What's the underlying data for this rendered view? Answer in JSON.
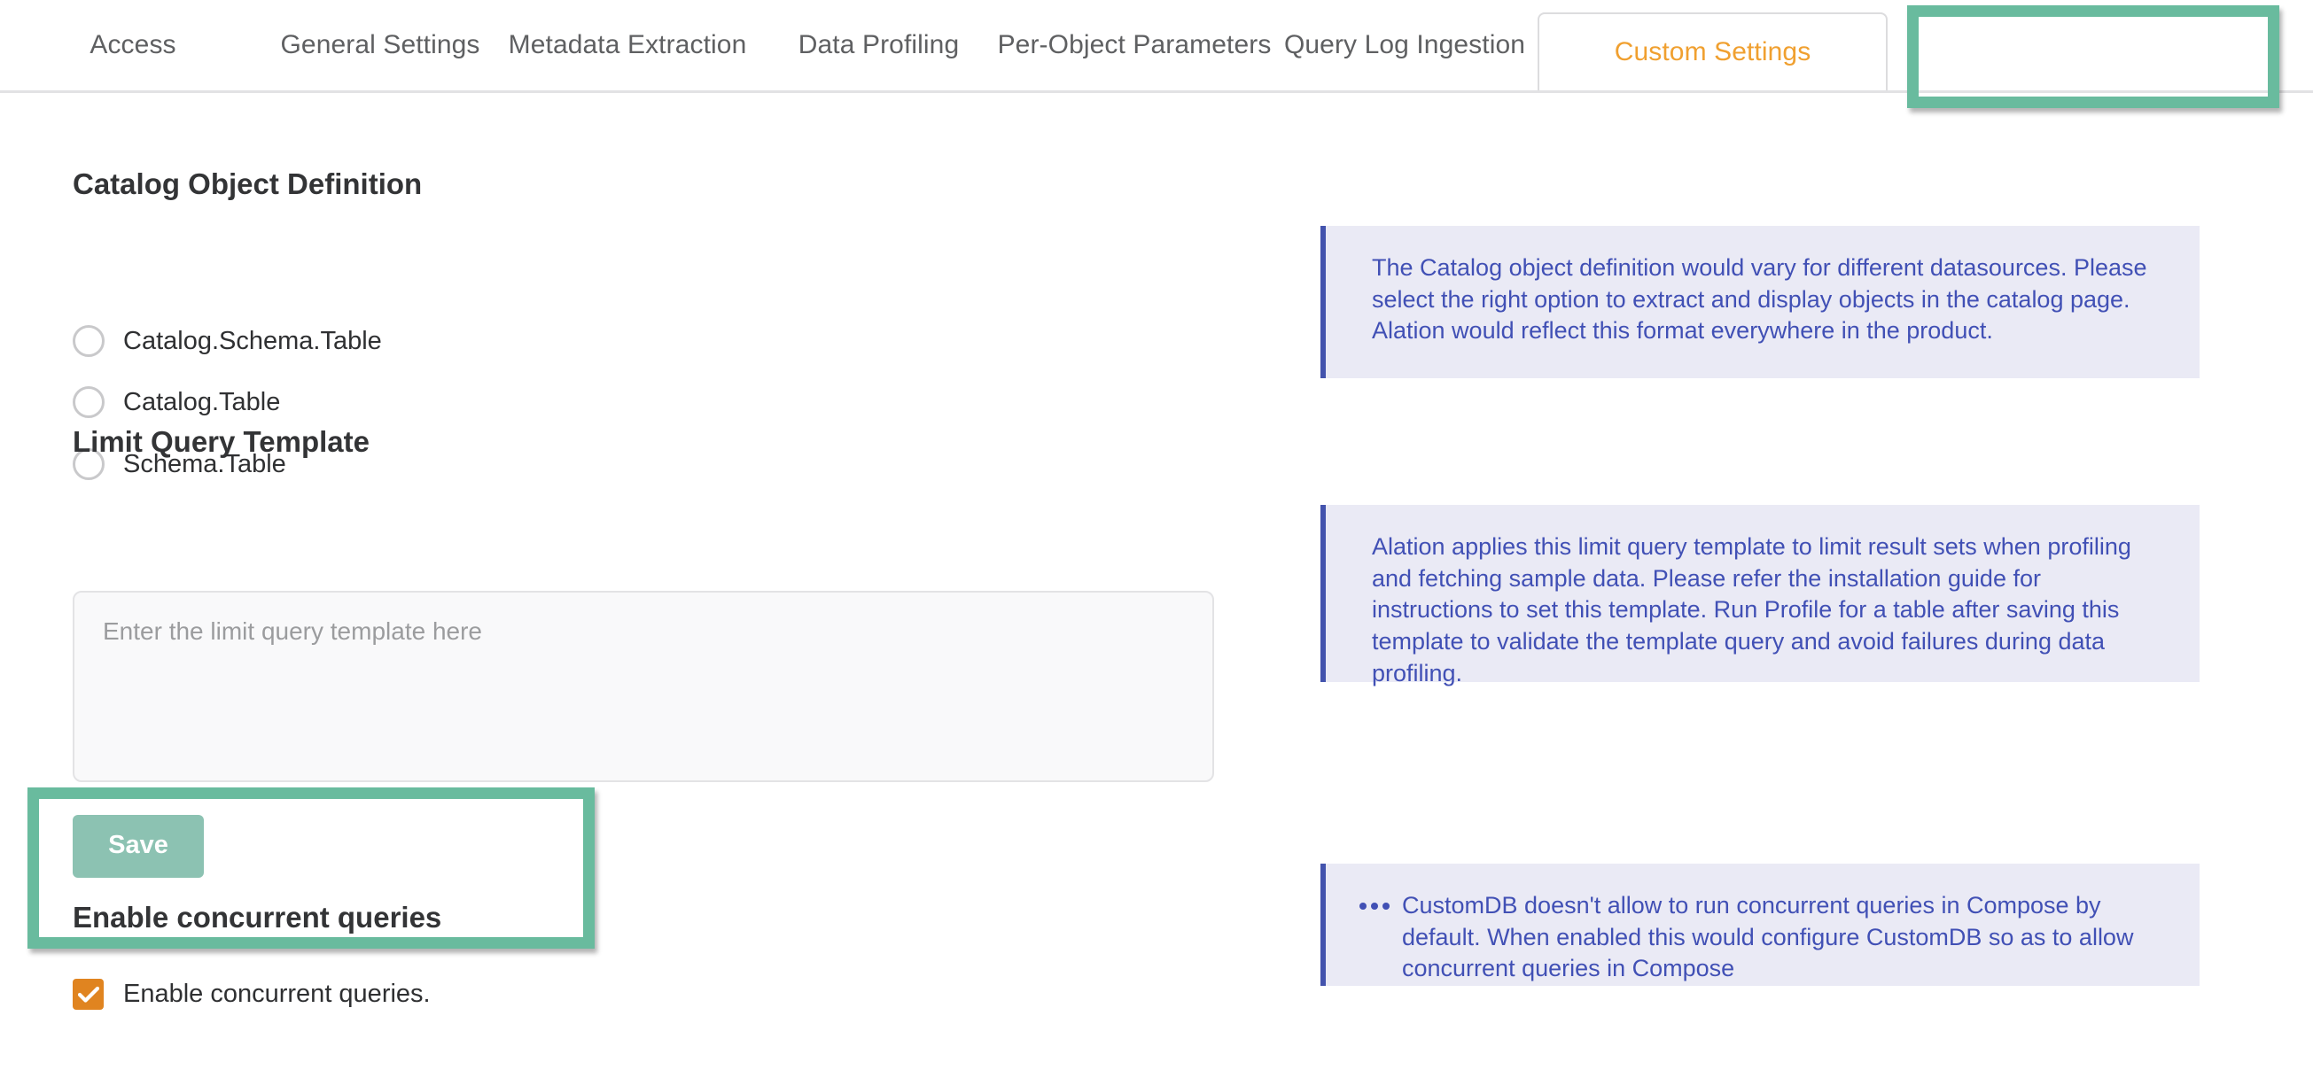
{
  "tabs": [
    {
      "label": "Access",
      "key": "access",
      "active": false
    },
    {
      "label": "General Settings",
      "key": "general",
      "active": false
    },
    {
      "label": "Metadata Extraction",
      "key": "metadata",
      "active": false
    },
    {
      "label": "Data Profiling",
      "key": "profiling",
      "active": false
    },
    {
      "label": "Per-Object Parameters",
      "key": "perobject",
      "active": false
    },
    {
      "label": "Query Log Ingestion",
      "key": "querylog",
      "active": false
    },
    {
      "label": "Custom Settings",
      "key": "custom",
      "active": true
    }
  ],
  "catalog_object_definition": {
    "heading": "Catalog Object Definition",
    "options": [
      {
        "label": "Catalog.Schema.Table",
        "selected": false
      },
      {
        "label": "Catalog.Table",
        "selected": false
      },
      {
        "label": "Schema.Table",
        "selected": false
      }
    ]
  },
  "limit_query_template": {
    "heading": "Limit Query Template",
    "value": "",
    "placeholder": "Enter the limit query template here"
  },
  "actions": {
    "save_label": "Save"
  },
  "enable_concurrent_queries": {
    "heading": "Enable concurrent queries",
    "checkbox_label": "Enable concurrent queries.",
    "checked": true
  },
  "info_panels": [
    {
      "id": "catalog-object-definition-info",
      "bulleted": false,
      "text": "The Catalog object definition would vary for different datasources. Please select the right option to extract and display objects in the catalog page. Alation would reflect this format everywhere in the product."
    },
    {
      "id": "limit-query-template-info",
      "bulleted": false,
      "text": "Alation applies this limit query template to limit result sets when profiling and fetching sample data. Please refer the installation guide for instructions to set this template. Run Profile for a table after saving this template to validate the template query and avoid failures during data profiling."
    },
    {
      "id": "concurrent-queries-info",
      "bulleted": true,
      "text": "CustomDB doesn't allow to run concurrent queries in Compose by default. When enabled this would configure CustomDB so as to allow concurrent queries in Compose"
    }
  ],
  "colors": {
    "active_tab_text": "#f0a030",
    "annotation_highlight": "#69bb9e",
    "save_button": "#8cc2b2",
    "checkbox_checked": "#e08420",
    "info_background": "#eaeaf5",
    "info_text": "#4150b5",
    "info_border": "#4353ad"
  }
}
